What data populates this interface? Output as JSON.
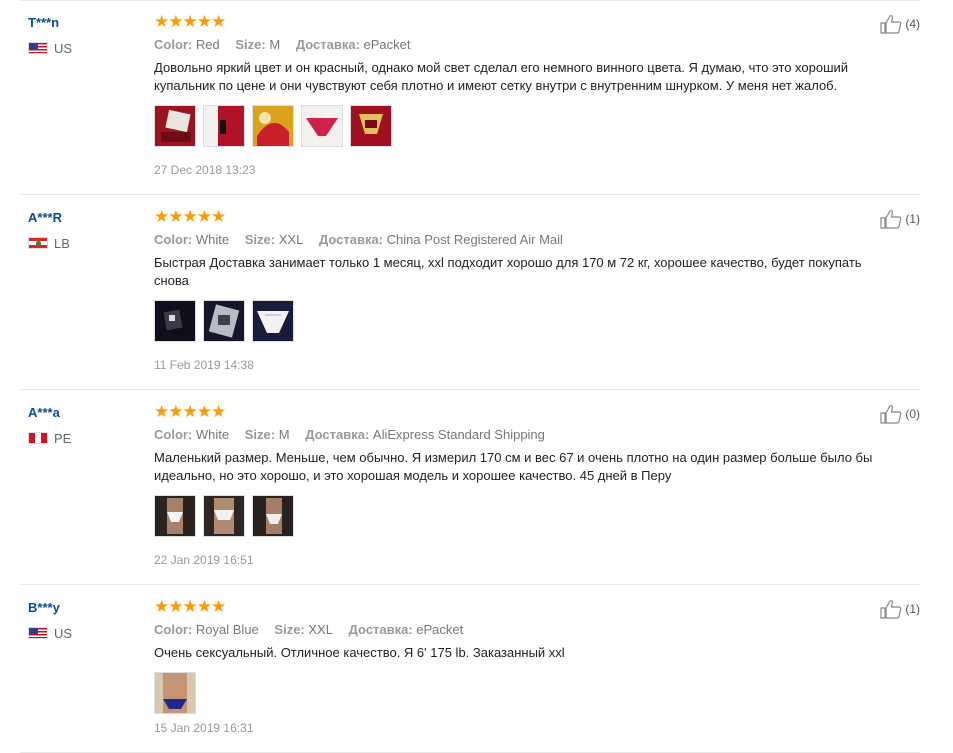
{
  "colors": {
    "star": "#ff9a00",
    "buyer_name": "#0b4aa3",
    "meta": "#999999",
    "divider": "#e8e8e8"
  },
  "reviews": [
    {
      "buyer": "T***n",
      "country": "US",
      "flag": "us-flag-icon",
      "rating": "★★★★★",
      "color_label": "Color:",
      "color_value": "Red",
      "size_label": "Size:",
      "size_value": "M",
      "delivery_label": "Доставка:",
      "delivery_value": "ePacket",
      "text": "Довольно яркий цвет и он красный, однако мой свет сделал его немного винного цвета. Я думаю, что это хороший купальник по цене и они чувствуют себя плотно и имеют сетку внутри с внутренним шнурком. У меня нет жалоб.",
      "photos": 5,
      "date": "27 Dec 2018 13:23",
      "helpful": "(4)"
    },
    {
      "buyer": "A***R",
      "country": "LB",
      "flag": "lebanon-flag-icon",
      "rating": "★★★★★",
      "color_label": "Color:",
      "color_value": "White",
      "size_label": "Size:",
      "size_value": "XXL",
      "delivery_label": "Доставка:",
      "delivery_value": "China Post Registered Air Mail",
      "text": "Быстрая Доставка занимает только 1 месяц, xxl подходит хорошо для 170 м 72 кг, хорошее качество, будет покупать снова",
      "photos": 3,
      "date": "11 Feb 2019 14:38",
      "helpful": "(1)"
    },
    {
      "buyer": "A***a",
      "country": "PE",
      "flag": "peru-flag-icon",
      "rating": "★★★★★",
      "color_label": "Color:",
      "color_value": "White",
      "size_label": "Size:",
      "size_value": "M",
      "delivery_label": "Доставка:",
      "delivery_value": "AliExpress Standard Shipping",
      "text": "Маленький размер. Меньше, чем обычно. Я измерил 170 см и вес 67 и очень плотно на один размер больше было бы идеально, но это хорошо, и это хорошая модель и хорошее качество. 45 дней в Перу",
      "photos": 3,
      "date": "22 Jan 2019 16:51",
      "helpful": "(0)"
    },
    {
      "buyer": "B***y",
      "country": "US",
      "flag": "us-flag-icon",
      "rating": "★★★★★",
      "color_label": "Color:",
      "color_value": "Royal Blue",
      "size_label": "Size:",
      "size_value": "XXL",
      "delivery_label": "Доставка:",
      "delivery_value": "ePacket",
      "text": "Очень сексуальный. Отличное качество. Я 6' 175 lb. Заказанный xxl",
      "photos": 1,
      "date": "15 Jan 2019 16:31",
      "helpful": "(1)"
    }
  ]
}
